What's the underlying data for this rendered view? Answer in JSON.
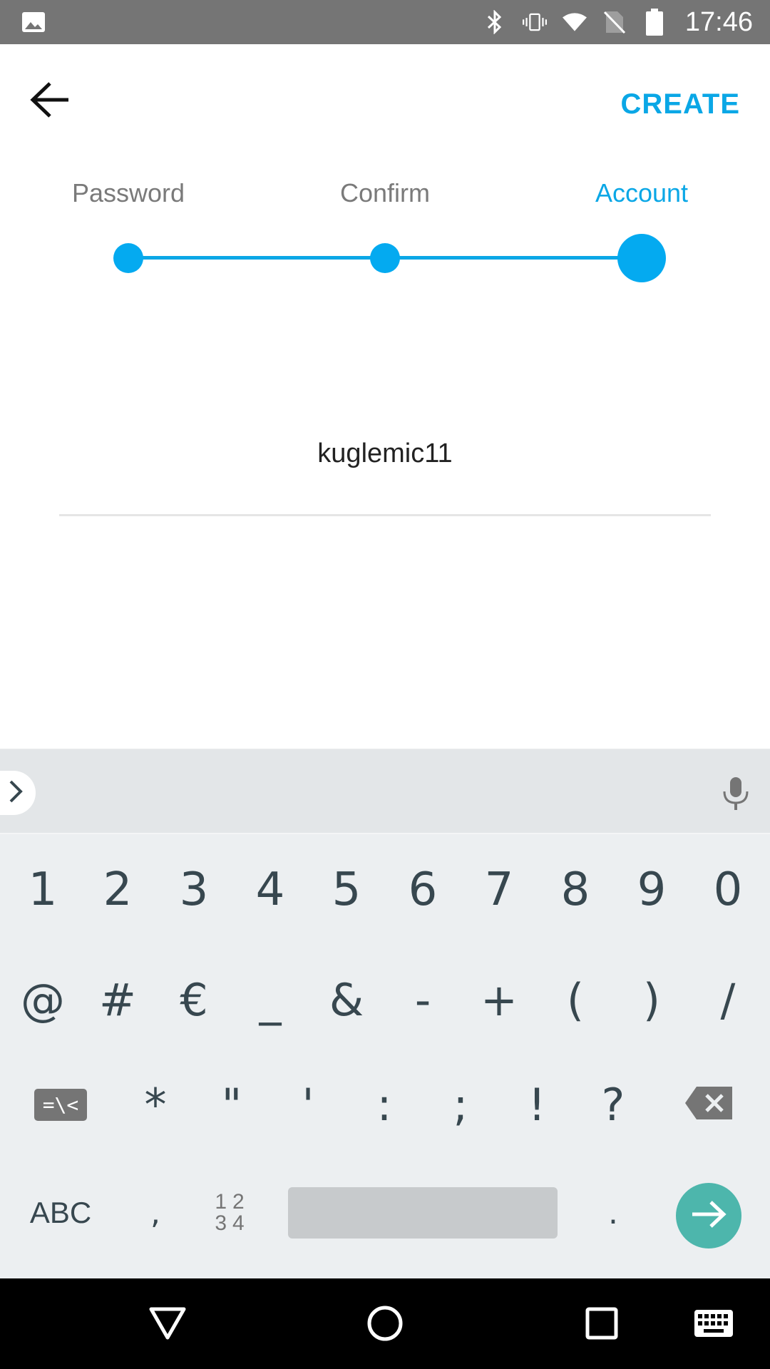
{
  "status_bar": {
    "time": "17:46",
    "icons": [
      "gallery-icon",
      "bluetooth-icon",
      "vibrate-icon",
      "wifi-icon",
      "no-sim-icon",
      "battery-icon"
    ]
  },
  "app_bar": {
    "back_icon": "arrow-back-icon",
    "create_label": "CREATE"
  },
  "stepper": {
    "steps": [
      {
        "label": "Password",
        "state": "complete"
      },
      {
        "label": "Confirm",
        "state": "complete"
      },
      {
        "label": "Account",
        "state": "active"
      }
    ]
  },
  "account_field": {
    "value": "kuglemic11"
  },
  "keyboard": {
    "row1": [
      "1",
      "2",
      "3",
      "4",
      "5",
      "6",
      "7",
      "8",
      "9",
      "0"
    ],
    "row2": [
      "@",
      "#",
      "€",
      "_",
      "&",
      "-",
      "+",
      "(",
      ")",
      "/"
    ],
    "row3": [
      "=\\<",
      "*",
      "\"",
      "'",
      ":",
      ";",
      "!",
      "?"
    ],
    "row4": {
      "abc_label": "ABC",
      "comma": ",",
      "numpad_top": "12",
      "numpad_bottom": "34",
      "period": "."
    },
    "icons": [
      "chevron-right-icon",
      "mic-icon",
      "backspace-icon",
      "enter-arrow-icon"
    ]
  },
  "nav_bar": {
    "icons": [
      "back-triangle-icon",
      "home-circle-icon",
      "recents-square-icon",
      "keyboard-icon"
    ]
  },
  "colors": {
    "accent": "#0aa7e6",
    "enter": "#4db6ac",
    "keyboard_bg": "#eceff1",
    "status_bar": "#757575"
  }
}
